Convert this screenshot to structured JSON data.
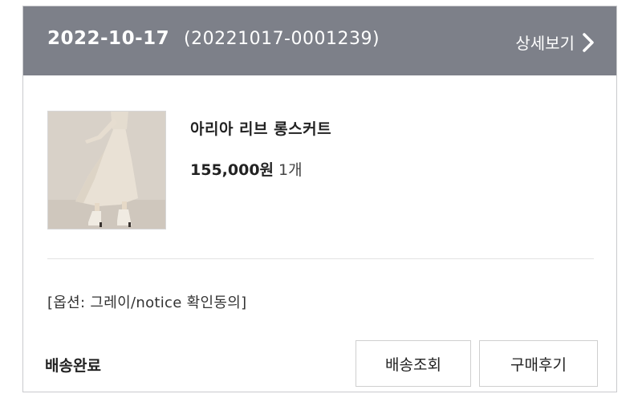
{
  "order": {
    "date": "2022-10-17",
    "number": "(20221017-0001239)",
    "detail_label": "상세보기"
  },
  "product": {
    "name": "아리아 리브 롱스커트",
    "price": "155,000원",
    "quantity": "1개",
    "option": "[옵션: 그레이/notice 확인동의]"
  },
  "status": "배송완료",
  "buttons": {
    "track": "배송조회",
    "review": "구매후기"
  },
  "colors": {
    "header_bg": "#7d8089",
    "border": "#c9cacd"
  }
}
